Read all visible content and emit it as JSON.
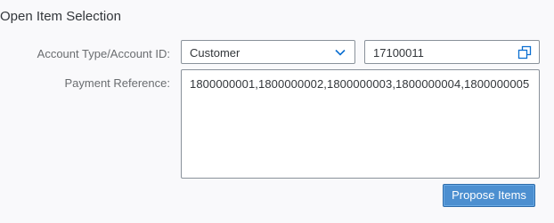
{
  "section": {
    "title": "Open Item Selection"
  },
  "form": {
    "account_label": "Account Type/Account ID:",
    "account_type": {
      "value": "Customer",
      "icon": "chevron-down-icon"
    },
    "account_id": {
      "value": "17100011",
      "icon": "value-help-icon"
    },
    "payment_label": "Payment Reference:",
    "payment_reference": {
      "value": "1800000001,1800000002,1800000003,1800000004,1800000005"
    }
  },
  "actions": {
    "propose_label": "Propose Items"
  },
  "colors": {
    "accent": "#4c8fd0",
    "icon": "#0a6ed1"
  }
}
